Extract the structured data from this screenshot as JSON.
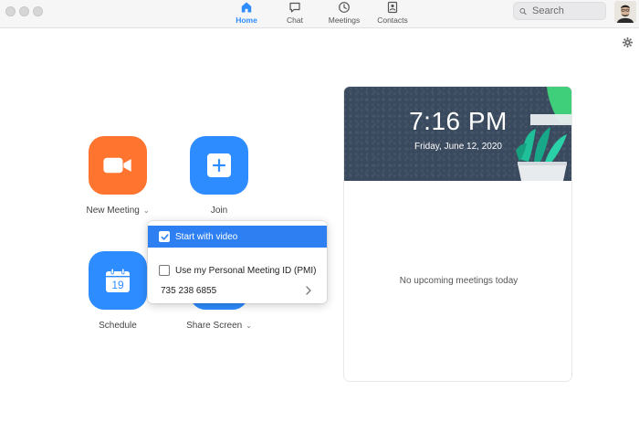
{
  "nav": {
    "tabs": [
      {
        "label": "Home",
        "icon": "home-icon",
        "active": true
      },
      {
        "label": "Chat",
        "icon": "chat-bubble-icon",
        "active": false
      },
      {
        "label": "Meetings",
        "icon": "clock-icon",
        "active": false
      },
      {
        "label": "Contacts",
        "icon": "contact-card-icon",
        "active": false
      }
    ]
  },
  "search": {
    "placeholder": "Search",
    "icon": "search-icon"
  },
  "actions": {
    "new_meeting": {
      "label": "New Meeting",
      "icon": "video-camera-icon",
      "color": "#ff742e"
    },
    "join": {
      "label": "Join",
      "icon": "plus-icon",
      "color": "#2d8cff"
    },
    "schedule": {
      "label": "Schedule",
      "icon": "calendar-icon",
      "calendar_day": "19",
      "color": "#2d8cff"
    },
    "share_screen": {
      "label": "Share Screen",
      "icon": "share-arrow-icon",
      "color": "#2d8cff"
    }
  },
  "dropdown": {
    "start_with_video": {
      "label": "Start with video",
      "checked": true
    },
    "use_pmi": {
      "label": "Use my Personal Meeting ID (PMI)",
      "checked": false
    },
    "pmi_number": "735 238 6855"
  },
  "card": {
    "time": "7:16 PM",
    "date": "Friday, June 12, 2020",
    "empty_message": "No upcoming meetings today"
  },
  "colors": {
    "accent": "#2d8cff",
    "orange": "#ff742e",
    "header_bg": "#3a4a5e",
    "menu_highlight": "#2d7ff2"
  }
}
